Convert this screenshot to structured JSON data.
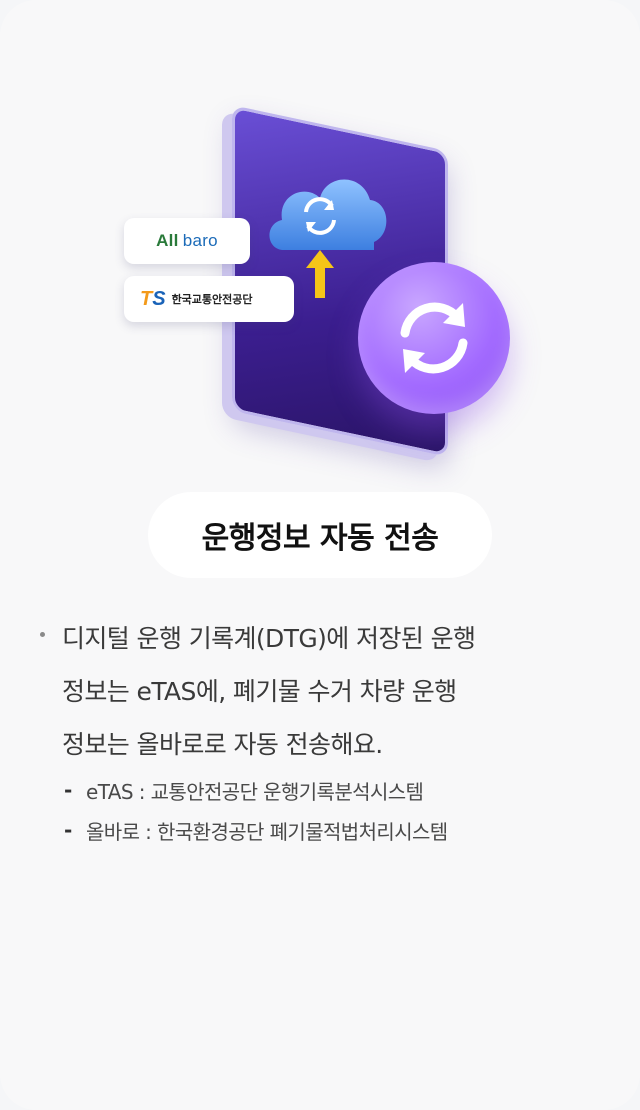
{
  "illustration": {
    "allbaro_logo": {
      "part1": "All",
      "part2": "baro"
    },
    "ts_logo": {
      "mark_t": "T",
      "mark_s": "S",
      "name": "한국교통안전공단"
    },
    "icons": [
      "cloud-sync-icon",
      "arrow-up-icon",
      "sync-icon"
    ],
    "colors": {
      "purple": "#a36bff",
      "device": "#3b1e8f",
      "arrow": "#f5c518",
      "cloud": "#4a90e2"
    }
  },
  "title": "운행정보 자동 전송",
  "body": {
    "lines": [
      "디지털 운행 기록계(DTG)에 저장된 운행",
      "정보는 eTAS에,  폐기물 수거 차량 운행",
      "정보는 올바로로 자동 전송해요."
    ],
    "sub_items": [
      {
        "dash": "-",
        "text": "eTAS : 교통안전공단 운행기록분석시스템"
      },
      {
        "dash": "-",
        "text": "올바로 : 한국환경공단 폐기물적법처리시스템"
      }
    ]
  }
}
